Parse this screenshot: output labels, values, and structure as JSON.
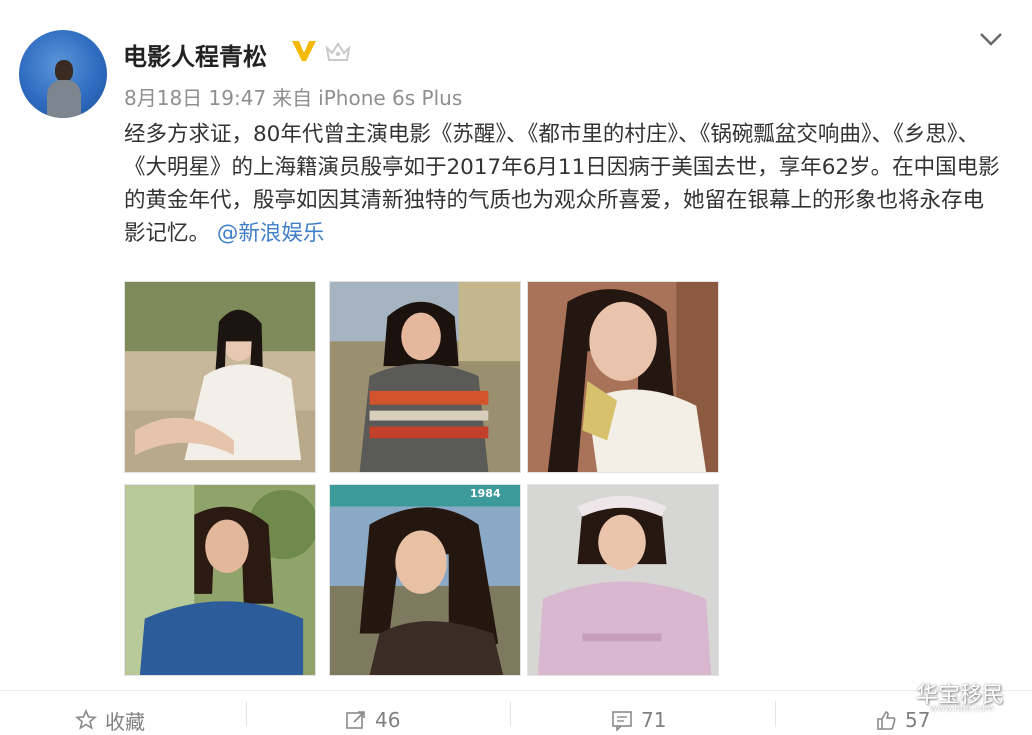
{
  "post": {
    "author": "电影人程青松",
    "time": "8月18日 19:47",
    "source_prefix": "来自",
    "source": "iPhone 6s Plus",
    "content_text": "经多方求证，80年代曾主演电影《苏醒》、《都市里的村庄》、《锅碗瓢盆交响曲》、《乡思》、《大明星》的上海籍演员殷亭如于2017年6月11日因病于美国去世，享年62岁。在中国电影的黄金年代，殷亭如因其清新独特的气质也为观众所喜爱，她留在银幕上的形象也将永存电影记忆。",
    "mention": "@新浪娱乐",
    "photo_label_year": "1984"
  },
  "actions": {
    "favorite_label": "收藏",
    "repost_count": "46",
    "comment_count": "71",
    "like_count": "57"
  },
  "watermark": {
    "text": "华宝移民",
    "url": "www.hb8.com"
  },
  "icons": {
    "verified": "verified-v-icon",
    "member": "crown-icon",
    "menu": "chevron-down-icon",
    "favorite": "star-icon",
    "repost": "repost-icon",
    "comment": "comment-icon",
    "like": "thumbs-up-icon"
  },
  "colors": {
    "verified": "#f5b800",
    "mention": "#3f7ec8",
    "meta": "#8f8f8f"
  }
}
